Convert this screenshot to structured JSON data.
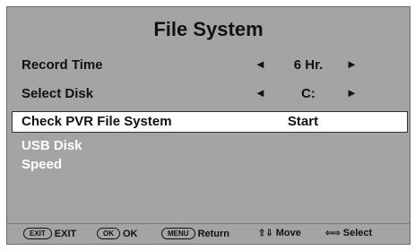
{
  "menu": {
    "title": "File System",
    "record_time": {
      "label": "Record Time",
      "left_arrow": "◄",
      "value": "6 Hr.",
      "right_arrow": "►"
    },
    "select_disk": {
      "label": "Select Disk",
      "left_arrow": "◄",
      "value": "C:",
      "right_arrow": "►"
    },
    "check_pvr": {
      "label": "Check PVR File System",
      "value": "Start"
    },
    "usb_disk": {
      "label": "USB Disk"
    },
    "speed": {
      "label": "Speed"
    }
  },
  "footer": {
    "exit_key": "EXIT",
    "exit_label": "EXIT",
    "ok_key": "OK",
    "ok_label": "OK",
    "menu_key": "MENU",
    "menu_label": "Return",
    "move_icon": "⇧⇩",
    "move_label": "Move",
    "select_icon": "⇦⇨",
    "select_label": "Select"
  }
}
